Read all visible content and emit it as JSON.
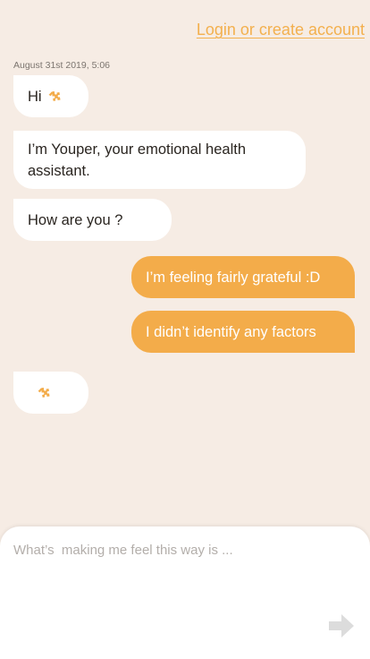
{
  "header": {
    "login_label": "Login or create account"
  },
  "chat": {
    "timestamp": "August 31st 2019, 5:06",
    "messages": [
      {
        "sender": "bot",
        "text": "Hi",
        "icon": "puzzle-icon"
      },
      {
        "sender": "bot",
        "text": "I’m Youper, your emotional health assistant."
      },
      {
        "sender": "bot",
        "text": "How are you ?"
      },
      {
        "sender": "user",
        "text": "I’m feeling fairly grateful :D"
      },
      {
        "sender": "user",
        "text": "I didn’t identify any factors"
      },
      {
        "sender": "bot",
        "text": "",
        "icon": "puzzle-icon"
      }
    ]
  },
  "composer": {
    "placeholder": "What’s  making me feel this way is ...",
    "send_icon": "arrow-right-icon"
  },
  "colors": {
    "background": "#f6ece4",
    "accent": "#f3ac4a",
    "bot_bubble": "#ffffff"
  }
}
